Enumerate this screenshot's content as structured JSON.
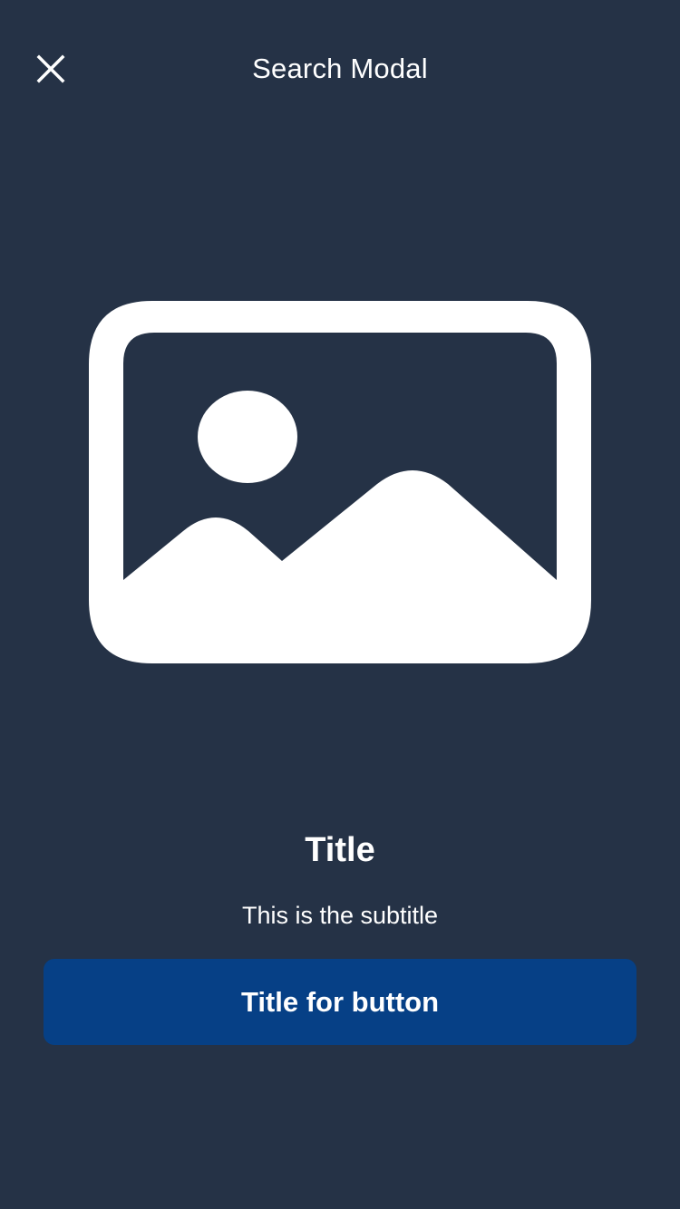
{
  "header": {
    "title": "Search Modal",
    "close_icon": "close-icon"
  },
  "hero": {
    "icon": "image-placeholder-icon"
  },
  "content": {
    "title": "Title",
    "subtitle": "This is the subtitle"
  },
  "actions": {
    "primary_label": "Title for button"
  },
  "colors": {
    "background": "#253246",
    "button": "#064086",
    "text": "#ffffff"
  }
}
